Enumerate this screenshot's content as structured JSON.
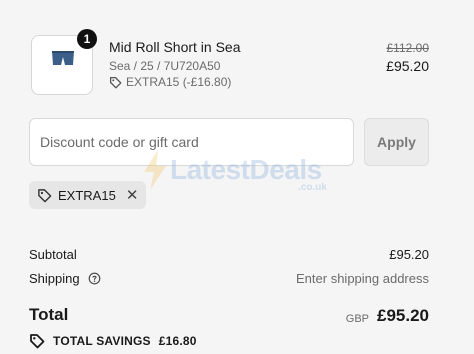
{
  "product": {
    "quantity": "1",
    "name": "Mid Roll Short in Sea",
    "variant": "Sea / 25 / 7U720A50",
    "discount_label": "EXTRA15 (-£16.80)",
    "original_price": "£112.00",
    "sale_price": "£95.20",
    "thumbnail_icon": "shorts-icon"
  },
  "discount_form": {
    "placeholder": "Discount code or gift card",
    "apply_label": "Apply"
  },
  "applied_code": {
    "code": "EXTRA15",
    "remove_icon": "close-icon"
  },
  "watermark": {
    "text": "LatestDeals",
    "sub": ".co.uk"
  },
  "summary": {
    "subtotal_label": "Subtotal",
    "subtotal_value": "£95.20",
    "shipping_label": "Shipping",
    "shipping_value": "Enter shipping address",
    "total_label": "Total",
    "currency": "GBP",
    "total_value": "£95.20",
    "savings_label": "TOTAL SAVINGS",
    "savings_value": "£16.80"
  },
  "colors": {
    "background": "#f5f5f5",
    "badge": "#111111",
    "muted_text": "#6b6b6b"
  }
}
